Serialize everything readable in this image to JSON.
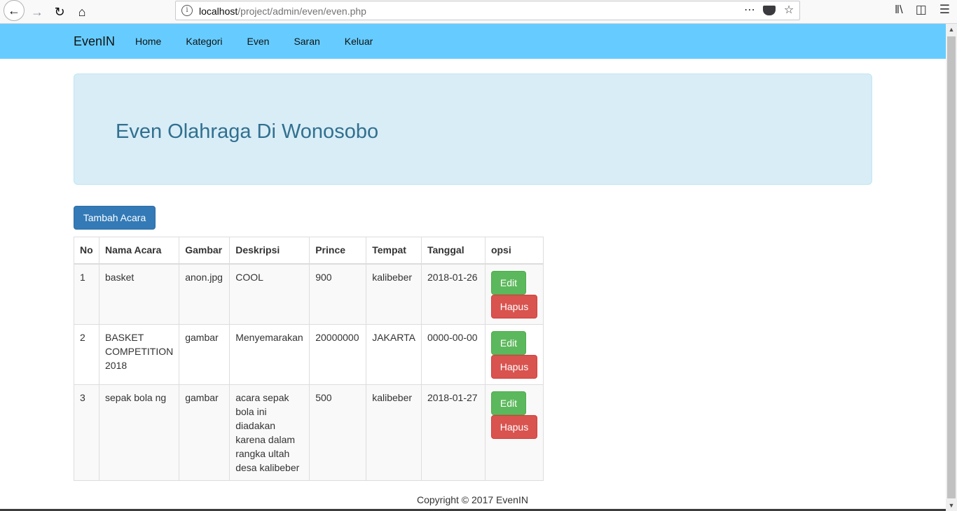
{
  "browser": {
    "url_host": "localhost",
    "url_path": "/project/admin/even/even.php"
  },
  "navbar": {
    "brand": "EvenIN",
    "links": [
      "Home",
      "Kategori",
      "Even",
      "Saran",
      "Keluar"
    ],
    "background": "#66ccff"
  },
  "jumbotron": {
    "title": "Even Olahraga Di Wonosobo"
  },
  "add_button": "Tambah Acara",
  "table": {
    "headers": [
      "No",
      "Nama Acara",
      "Gambar",
      "Deskripsi",
      "Prince",
      "Tempat",
      "Tanggal",
      "opsi"
    ],
    "rows": [
      {
        "no": "1",
        "nama": "basket",
        "gambar": "anon.jpg",
        "deskripsi": "COOL",
        "prince": "900",
        "tempat": "kalibeber",
        "tanggal": "2018-01-26"
      },
      {
        "no": "2",
        "nama": "BASKET COMPETITION 2018",
        "gambar": "gambar",
        "deskripsi": "Menyemarakan",
        "prince": "20000000",
        "tempat": "JAKARTA",
        "tanggal": "0000-00-00"
      },
      {
        "no": "3",
        "nama": "sepak bola ng",
        "gambar": "gambar",
        "deskripsi": "acara sepak bola ini diadakan karena dalam rangka ultah desa kalibeber",
        "prince": "500",
        "tempat": "kalibeber",
        "tanggal": "2018-01-27"
      }
    ],
    "edit_label": "Edit",
    "delete_label": "Hapus"
  },
  "footer": "Copyright © 2017 EvenIN"
}
